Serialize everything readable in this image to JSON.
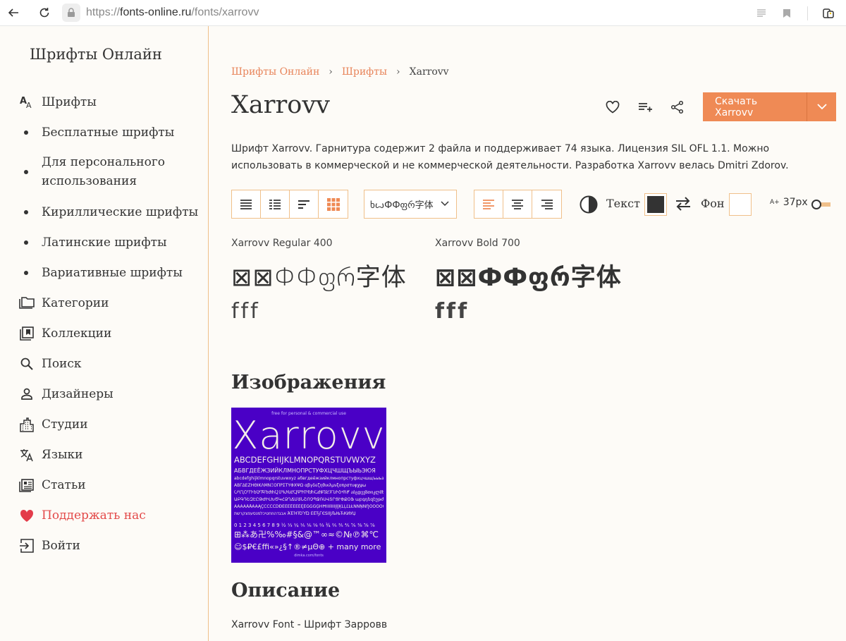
{
  "browser": {
    "url_prefix": "https://",
    "url_host": "fonts-online.ru",
    "url_path": "/fonts/xarrovv"
  },
  "sidebar": {
    "logo": "Шрифты Онлайн",
    "items": [
      {
        "label": "Шрифты",
        "icon": "font-icon"
      },
      {
        "label": "Бесплатные шрифты",
        "icon": "bullet"
      },
      {
        "label": "Для персонального использования",
        "icon": "bullet"
      },
      {
        "label": "Кириллические шрифты",
        "icon": "bullet"
      },
      {
        "label": "Латинские шрифты",
        "icon": "bullet"
      },
      {
        "label": "Вариативные шрифты",
        "icon": "bullet"
      },
      {
        "label": "Категории",
        "icon": "folder-icon"
      },
      {
        "label": "Коллекции",
        "icon": "collection-icon"
      },
      {
        "label": "Поиск",
        "icon": "search-icon"
      },
      {
        "label": "Дизайнеры",
        "icon": "person-icon"
      },
      {
        "label": "Студии",
        "icon": "building-icon"
      },
      {
        "label": "Языки",
        "icon": "translate-icon"
      },
      {
        "label": "Статьи",
        "icon": "article-icon"
      },
      {
        "label": "Поддержать нас",
        "icon": "heart-icon"
      },
      {
        "label": "Войти",
        "icon": "login-icon"
      }
    ]
  },
  "breadcrumb": {
    "home": "Шрифты Онлайн",
    "fonts": "Шрифты",
    "current": "Xarrovv"
  },
  "page_title": "Xarrovv",
  "download_label": "Скачать Xarrovv",
  "description": "Шрифт Xarrovv. Гарнитура содержит 2 файла и поддерживает 74 языка. Лицензия SIL OFL 1.1. Можно использовать в коммерческой и не коммерческой деятельности. Разработка Xarrovv велась Dmitri Zdorov.",
  "toolbar": {
    "sample_text_value": "ხꙍФФფრ字体",
    "text_label": "Текст",
    "bg_label": "Фон",
    "size_value": "37px",
    "size_prefix": "A+",
    "text_color": "#333333",
    "bg_color": "#ffffff"
  },
  "styles": [
    {
      "name": "Xarrovv Regular 400",
      "sample": "⊠⊠ФФფრ字体",
      "sample2": "fff"
    },
    {
      "name": "Xarrovv Bold 700",
      "sample": "⊠⊠ФФფრ字体",
      "sample2": "fff"
    }
  ],
  "images_heading": "Изображения",
  "preview": {
    "top": "free for personal & commercial use",
    "title": "Xarrovv",
    "line1": "ABCDEFGHIJKLMNOPQRSTUVWXYZ",
    "line2": "АБВГДЕЁЖЗИЙКЛМНОПРСТУФХЦЧШЩЪЫЬЭЮЯ",
    "line3": "abcdefghijklmnopqrstuvwxyz абвгдеёжзийклмнопрстуфхцчшщъыьэюя",
    "line4": "ΑΒΓΔΕΖΗΘΙΚΛΜΝΞΟΠΡΣΤΥΦΧΨΩ αβγδεζηθικλμνξοπρστυφχψω",
    "line5": "ႠႡႢႣႤႥႦႧႨႩႪႫႬႭႮႯႰႱႲႳႴႵႶႷႸႹႺႻႼႽႾႿჀჁჂჃჄჅ აბგდევზთიკლმნოპჟრსტუფქღყშჩცძწჭხჯჰ",
    "line6": "ԱԲԳԴԵԶԷԸԹԺԻԼԽԾԿՀՁՂՃՄՅՆՇՈՉՊՋՌՍՎՏՐՑՒՓՔՕՖ աբգդեզէըթժիլխծկհձղճմյնշոչպջռսվտրցւփքօֆ",
    "line7": "ÀÁÂÃÄÅĀĂĄÇĆĈĊČĎĐÈÉÊËĒĔĖĘĚĜĞĠĢĤĦÌÍÎÏĨĪĬĮİĴĶĹĻĽĿŁÑŃŅŇŊÒÓÔÕÖØŌŎŐŒŔŖŘŚŜŞŠŢŤŦÙÚÛÜŨŪŬŮŰŲŴÝŶŸŹŻŽ",
    "line8": "אבגדהוזחטיכלמנסעפצקרשת ΆΈΉΊΌΎΏ ЀЁЂЃЄЅІЇЈЉЊЋЌЍЎЏ",
    "line9": "0 1 2 3 4 5 6 7 8 9 ½ ⅓ ¼ ⅕ ⅙ ⅛ ⅔ ¾ ⅖ ⅗ ⅘ ⅚ ⅜ ⅝ ⅞",
    "line10": "⊞⁂あ卍%‰#§&@™∞≈©№℗⌘℃",
    "line11": "☺$₽€£ffi«»¿§↑®≠μΘ⊕ + many more",
    "foot": "dimka.com/fonts"
  },
  "description_heading": "Описание",
  "body_text": "Xarrovv Font - Шрифт Зарровв"
}
